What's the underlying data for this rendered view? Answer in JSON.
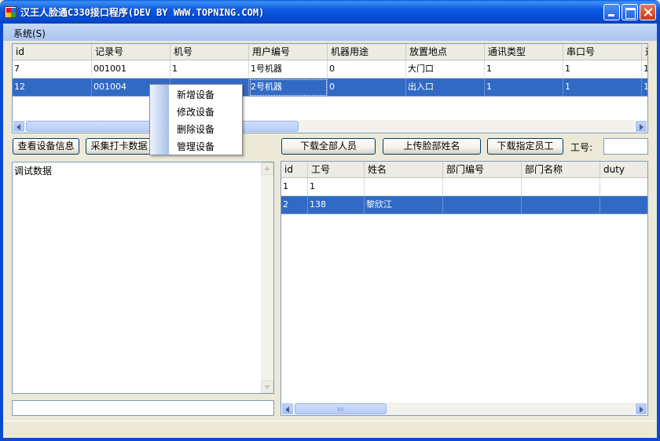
{
  "window": {
    "title": "汉王人脸通C330接口程序(DEV BY WWW.TOPNING.COM)"
  },
  "menu": {
    "system": "系统(S)"
  },
  "device_grid": {
    "columns": [
      "id",
      "记录号",
      "机号",
      "用户编号",
      "机器用途",
      "放置地点",
      "通讯类型",
      "串口号",
      "通"
    ],
    "rows": [
      [
        "7",
        "001001",
        "1",
        "1号机器",
        "0",
        "大门口",
        "1",
        "1",
        "1"
      ],
      [
        "12",
        "001004",
        "",
        "2号机器",
        "0",
        "出入口",
        "1",
        "1",
        "1"
      ]
    ],
    "selected_row": 1
  },
  "context_menu": {
    "items": [
      "新增设备",
      "修改设备",
      "删除设备",
      "管理设备"
    ]
  },
  "buttons": {
    "view_device_info": "查看设备信息",
    "collect_punch_data": "采集打卡数据",
    "download_all": "下载全部人员",
    "upload_face_name": "上传脸部姓名",
    "download_specified": "下载指定员工"
  },
  "employee_no_label": "工号:",
  "debug_box": {
    "text": "调试数据"
  },
  "employee_grid": {
    "columns": [
      "id",
      "工号",
      "姓名",
      "部门编号",
      "部门名称",
      "duty"
    ],
    "rows": [
      [
        "1",
        "1",
        "",
        "",
        "",
        ""
      ],
      [
        "2",
        "138",
        "黎欣江",
        "",
        "",
        ""
      ]
    ],
    "selected_row": 1
  }
}
